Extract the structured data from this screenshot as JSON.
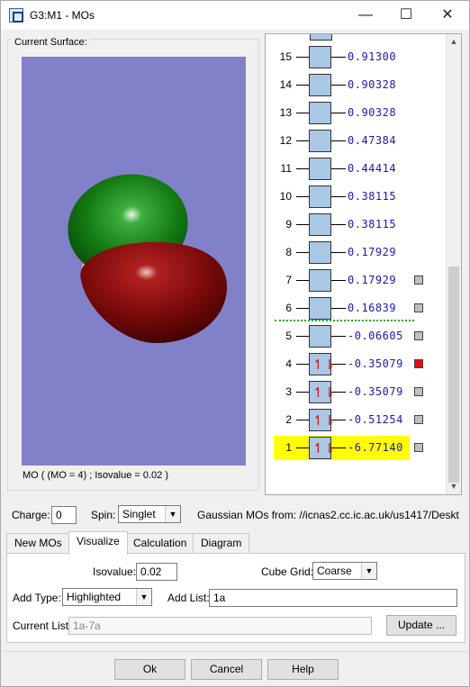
{
  "window": {
    "title": "G3:M1 - MOs",
    "min_glyph": "—",
    "max_glyph": "☐",
    "close_glyph": "✕"
  },
  "surface": {
    "group_label": "Current Surface:",
    "caption": "MO ( (MO = 4) ; Isovalue = 0.02 )"
  },
  "orbitals": [
    {
      "n": "15",
      "energy": "0.91300",
      "occ": 0,
      "sel": ""
    },
    {
      "n": "14",
      "energy": "0.90328",
      "occ": 0,
      "sel": ""
    },
    {
      "n": "13",
      "energy": "0.90328",
      "occ": 0,
      "sel": ""
    },
    {
      "n": "12",
      "energy": "0.47384",
      "occ": 0,
      "sel": ""
    },
    {
      "n": "11",
      "energy": "0.44414",
      "occ": 0,
      "sel": ""
    },
    {
      "n": "10",
      "energy": "0.38115",
      "occ": 0,
      "sel": ""
    },
    {
      "n": "9",
      "energy": "0.38115",
      "occ": 0,
      "sel": ""
    },
    {
      "n": "8",
      "energy": "0.17929",
      "occ": 0,
      "sel": ""
    },
    {
      "n": "7",
      "energy": "0.17929",
      "occ": 0,
      "sel": "grey"
    },
    {
      "n": "6",
      "energy": "0.16839",
      "occ": 0,
      "sel": "grey"
    },
    {
      "n": "5",
      "energy": "-0.06605",
      "occ": 0,
      "sel": "grey"
    },
    {
      "n": "4",
      "energy": "-0.35079",
      "occ": 2,
      "sel": "red"
    },
    {
      "n": "3",
      "energy": "-0.35079",
      "occ": 2,
      "sel": "grey"
    },
    {
      "n": "2",
      "energy": "-0.51254",
      "occ": 2,
      "sel": "grey"
    },
    {
      "n": "1",
      "energy": "-6.77140",
      "occ": 2,
      "sel": "grey"
    }
  ],
  "spin_glyph": "↿⇂",
  "charge": {
    "label": "Charge:",
    "value": "0"
  },
  "spin": {
    "label": "Spin:",
    "value": "Singlet"
  },
  "source": {
    "text": "Gaussian MOs from:  //icnas2.cc.ic.ac.uk/us1417/Deskt"
  },
  "tabs": [
    {
      "label": "New MOs"
    },
    {
      "label": "Visualize"
    },
    {
      "label": "Calculation"
    },
    {
      "label": "Diagram"
    }
  ],
  "visualize": {
    "isovalue_label": "Isovalue:",
    "isovalue": "0.02",
    "cubegrid_label": "Cube Grid:",
    "cubegrid": "Coarse",
    "addtype_label": "Add Type:",
    "addtype": "Highlighted",
    "addlist_label": "Add List:",
    "addlist": "1a",
    "currentlist_label": "Current List:",
    "currentlist": "1a-7a",
    "update_label": "Update ..."
  },
  "footer": {
    "ok": "Ok",
    "cancel": "Cancel",
    "help": "Help"
  }
}
